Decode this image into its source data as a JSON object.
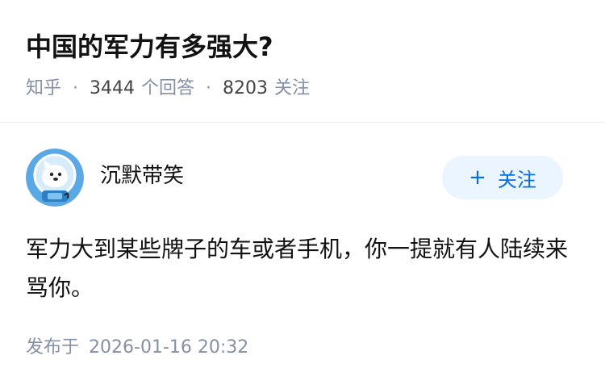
{
  "question": {
    "title": "中国的军力有多强大?",
    "source": "知乎",
    "answer_count": "3444",
    "answer_label": "个回答",
    "follower_count": "8203",
    "follower_label": "关注",
    "separator": "·"
  },
  "answer": {
    "author_name": "沉默带笑",
    "follow_label": "关注",
    "follow_icon": "+",
    "content": "军力大到某些牌子的车或者手机，你一提就有人陆续来骂你。",
    "publish_label": "发布于",
    "publish_time": "2026-01-16 20:32"
  },
  "colors": {
    "accent": "#056de8",
    "accent_bg": "#ebf5ff",
    "meta_gray": "#8590a6",
    "text": "#121212",
    "avatar_bg": "#5aa9e6"
  }
}
